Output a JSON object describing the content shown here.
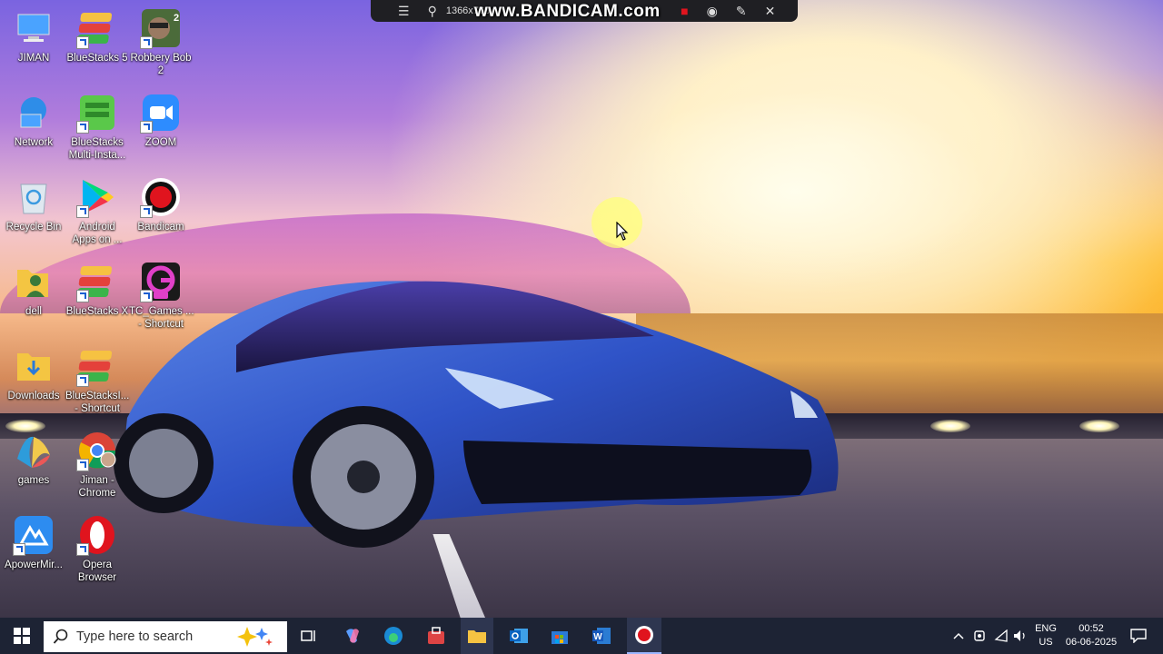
{
  "recorder_overlay": {
    "resolution_text": "1366x768",
    "watermark": "www.BANDICAM.com"
  },
  "desktop_icons": [
    {
      "label": "JIMAN",
      "icon": "computer-icon"
    },
    {
      "label": "BlueStacks 5",
      "icon": "bluestacks-icon"
    },
    {
      "label": "Robbery Bob\n2",
      "icon": "game-icon"
    },
    {
      "label": "Network",
      "icon": "network-icon"
    },
    {
      "label": "BlueStacks\nMulti-Insta...",
      "icon": "bluestacks-multi-icon"
    },
    {
      "label": "ZOOM",
      "icon": "zoom-icon"
    },
    {
      "label": "Recycle Bin",
      "icon": "recycle-bin-icon"
    },
    {
      "label": "Android\nApps on ...",
      "icon": "play-store-icon"
    },
    {
      "label": "Bandicam",
      "icon": "bandicam-icon"
    },
    {
      "label": "dell",
      "icon": "user-folder-icon"
    },
    {
      "label": "BlueStacks X",
      "icon": "bluestacks-x-icon"
    },
    {
      "label": "TC_Games ...\n- Shortcut",
      "icon": "tc-games-icon"
    },
    {
      "label": "Downloads",
      "icon": "folder-download-icon"
    },
    {
      "label": "BlueStacksI...\n- Shortcut",
      "icon": "bluestacks-installer-icon"
    },
    {
      "label": "games",
      "icon": "games-icon"
    },
    {
      "label": "Jiman -\nChrome",
      "icon": "chrome-icon"
    },
    {
      "label": "ApowerMir...",
      "icon": "apowermirror-icon"
    },
    {
      "label": "Opera\nBrowser",
      "icon": "opera-icon"
    }
  ],
  "taskbar": {
    "search_placeholder": "Type here to search",
    "language": "ENG",
    "region": "US",
    "time": "00:52",
    "date": "06-06-2025"
  },
  "colors": {
    "taskbar_bg": "#1d2334",
    "recording_red": "#e0141e"
  }
}
